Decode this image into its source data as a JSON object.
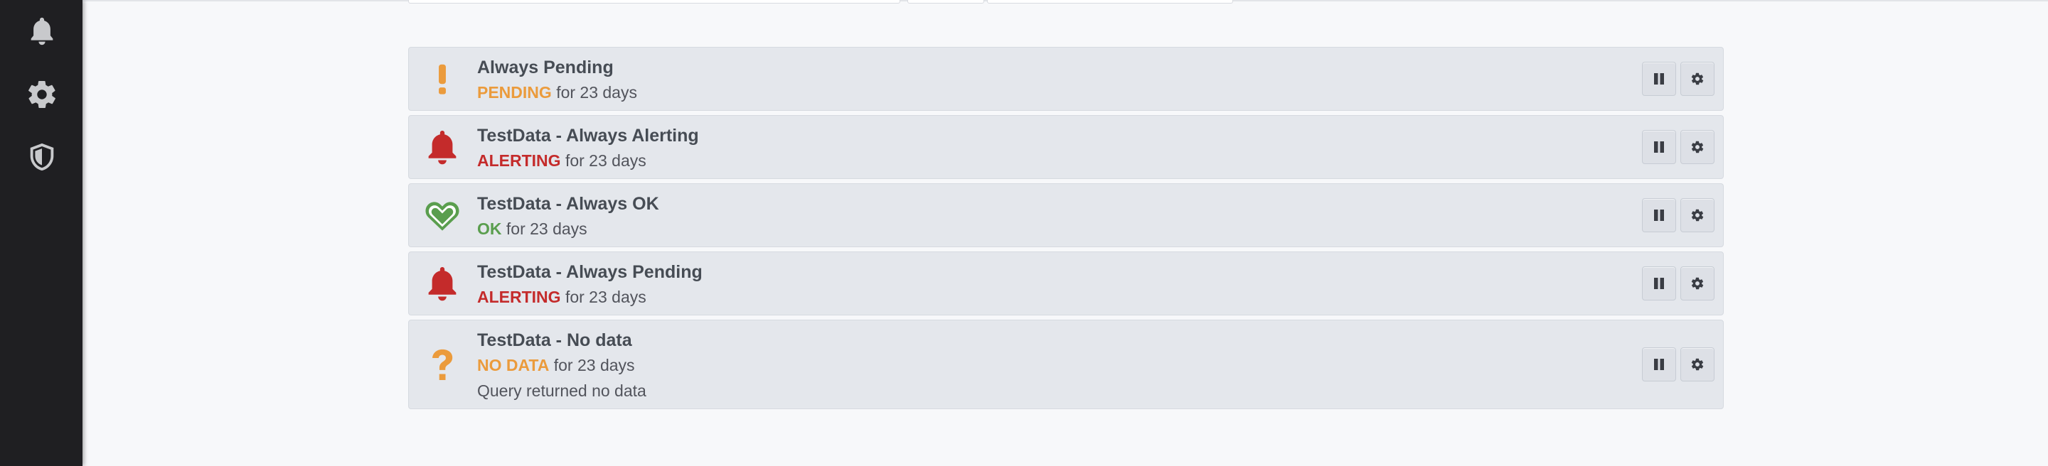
{
  "sidebar": {
    "items": [
      {
        "icon": "bell-icon"
      },
      {
        "icon": "gear-icon"
      },
      {
        "icon": "shield-icon"
      }
    ]
  },
  "colors": {
    "pending": "#eb9b3c",
    "alerting": "#c42b2b",
    "ok": "#5a9e4e",
    "no_data": "#eb9b3c"
  },
  "alerts": [
    {
      "name": "Always Pending",
      "state": "PENDING",
      "duration": "for 23 days",
      "info": "",
      "icon": "exclamation-icon"
    },
    {
      "name": "TestData - Always Alerting",
      "state": "ALERTING",
      "duration": "for 23 days",
      "info": "",
      "icon": "bell-icon"
    },
    {
      "name": "TestData - Always OK",
      "state": "OK",
      "duration": "for 23 days",
      "info": "",
      "icon": "heart-icon"
    },
    {
      "name": "TestData - Always Pending",
      "state": "ALERTING",
      "duration": "for 23 days",
      "info": "",
      "icon": "bell-icon"
    },
    {
      "name": "TestData - No data",
      "state": "NO DATA",
      "duration": "for 23 days",
      "info": "Query returned no data",
      "icon": "question-icon"
    }
  ]
}
